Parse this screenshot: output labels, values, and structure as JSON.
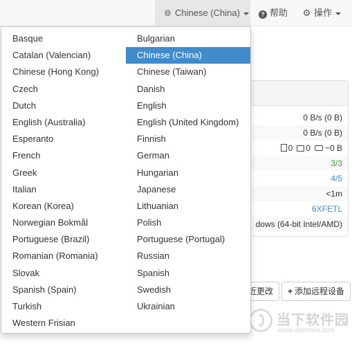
{
  "navbar": {
    "language_label": "Chinese (China)",
    "help_label": "帮助",
    "actions_label": "操作"
  },
  "background": {
    "rows": [
      "0 B/s (0 B)",
      "0 B/s (0 B)",
      "0",
      "0",
      "~0 B",
      "3/3",
      "4/5",
      "<1m",
      "6XFETL",
      "dows (64-bit Intel/AMD)"
    ],
    "recent_changes_label": "近更改",
    "add_device_label": "添加远程设备"
  },
  "languages_left": [
    "Basque",
    "Catalan (Valencian)",
    "Chinese (Hong Kong)",
    "Czech",
    "Dutch",
    "English (Australia)",
    "Esperanto",
    "French",
    "Greek",
    "Italian",
    "Korean (Korea)",
    "Norwegian Bokmål",
    "Portuguese (Brazil)",
    "Romanian (Romania)",
    "Slovak",
    "Spanish (Spain)",
    "Turkish",
    "Western Frisian"
  ],
  "languages_right": [
    "Bulgarian",
    "Chinese (China)",
    "Chinese (Taiwan)",
    "Danish",
    "English",
    "English (United Kingdom)",
    "Finnish",
    "German",
    "Hungarian",
    "Japanese",
    "Lithuanian",
    "Polish",
    "Portuguese (Portugal)",
    "Russian",
    "Spanish",
    "Swedish",
    "Ukrainian"
  ],
  "selected_language": "Chinese (China)",
  "watermark": {
    "brand": "当下软件园",
    "url": "www.downxia.com"
  },
  "colors": {
    "accent": "#428bca",
    "green": "#3c9a3c"
  }
}
